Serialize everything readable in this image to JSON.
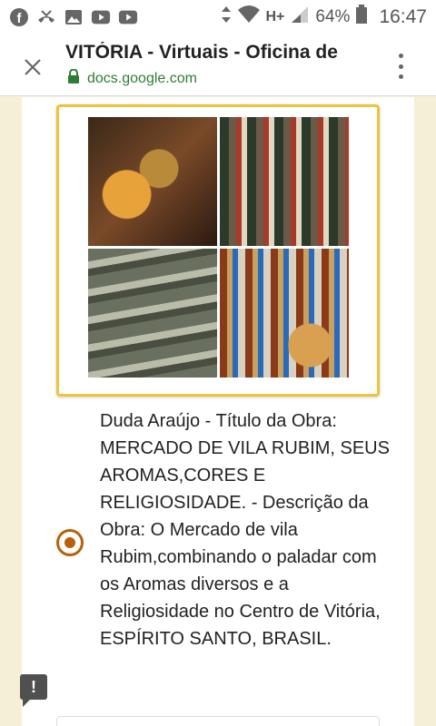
{
  "status_bar": {
    "icons_left": [
      "facebook-icon",
      "missed-call-icon",
      "image-icon",
      "youtube-icon",
      "youtube-icon"
    ],
    "network": "H+",
    "battery": "64%",
    "time": "16:47"
  },
  "toolbar": {
    "title": "VITÓRIA - Virtuais - Oficina de",
    "url": "docs.google.com"
  },
  "question": {
    "option_text": "Duda Araújo - Título da Obra: MERCADO DE VILA RUBIM, SEUS AROMAS,CORES E RELIGIOSIDADE. - Descrição da Obra: O Mercado de vila Rubim,combinando o paladar com os Aromas diversos e a Religiosidade no Centro de Vitória, ESPÍRITO SANTO, BRASIL.",
    "selected": true
  },
  "feedback": {
    "label": "!"
  },
  "colors": {
    "accent": "#b8610a",
    "frame": "#f0c43a",
    "background": "#f5efd6",
    "url": "#2e7d32"
  }
}
